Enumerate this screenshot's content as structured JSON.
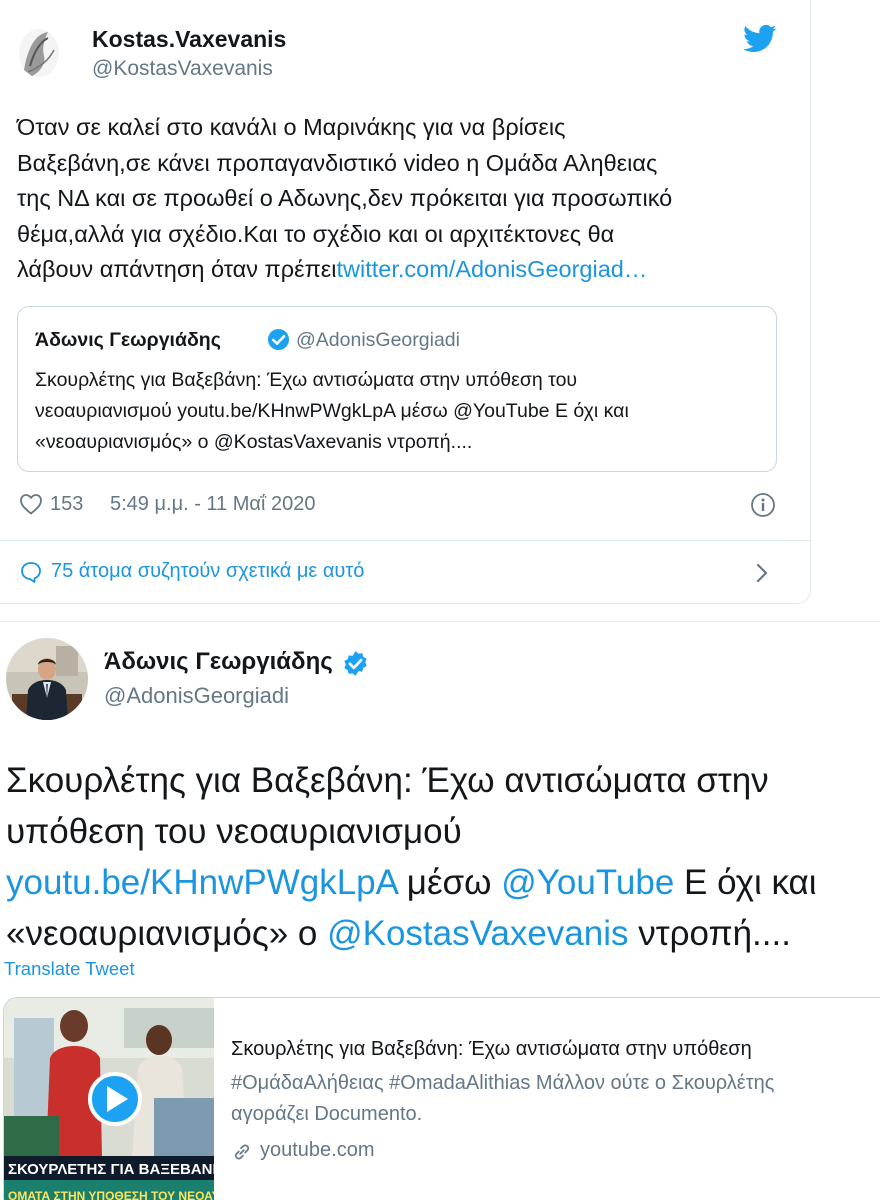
{
  "tweet1": {
    "author_name": "Kostas.Vaxevanis",
    "author_handle": "@KostasVaxevanis",
    "text_lines": [
      "Όταν σε καλεί στο κανάλι ο Μαρινάκης για να βρίσεις",
      "Βαξεβάνη,σε κάνει προπαγανδιστικό video η Ομάδα Αληθειας",
      "της ΝΔ και σε προωθεί ο Αδωνης,δεν πρόκειται για προσωπικό",
      "θέμα,αλλά για σχέδιο.Και το σχέδιο και οι αρχιτέκτονες θα"
    ],
    "text_last_line": "λάβουν απάντηση όταν πρέπει",
    "text_link": "twitter.com/AdonisGeorgiad…",
    "quoted": {
      "author_name": "Άδωνις Γεωργιάδης",
      "author_handle": "@AdonisGeorgiadi",
      "text_lines": [
        "Σκουρλέτης για Βαξεβάνη: Έχω αντισώματα στην υπόθεση του",
        "νεοαυριανισμού youtu.be/KHnwPWgkLpA μέσω @YouTube Ε όχι και",
        "«νεοαυριανισμός» ο @KostasVaxevanis ντροπή...."
      ]
    },
    "likes": "153",
    "timestamp": "5:49 μ.μ. - 11 Μαΐ 2020",
    "conversation": "75 άτομα συζητούν σχετικά με αυτό"
  },
  "tweet2": {
    "author_name": "Άδωνις Γεωργιάδης",
    "author_handle": "@AdonisGeorgiadi",
    "line1": "Σκουρλέτης για Βαξεβάνη: Έχω αντισώματα στην",
    "line2": "υπόθεση του νεοαυριανισμού",
    "line3_link1": "youtu.be/KHnwPWgkLpA",
    "line3_mid": " μέσω ",
    "line3_link2": "@YouTube",
    "line3_tail": " Ε όχι και",
    "line4_head": "«νεοαυριανισμός» ο ",
    "line4_link": "@KostasVaxevanis",
    "line4_tail": " ντροπή....",
    "translate": "Translate Tweet",
    "card": {
      "thumb_caption_1": "ΣΚΟΥΡΛΕΤΗΣ ΓΙΑ ΒΑΞΕΒΑΝΗ",
      "thumb_caption_2": "ΟΜΑΤΑ ΣΤΗΝ ΥΠΟΘΕΣΗ ΤΟΥ ΝΕΟΑΥ",
      "title": "Σκουρλέτης για Βαξεβάνη: Έχω αντισώματα στην υπόθεση",
      "desc_line1": "#ΟμάδαΑλήθειας #OmadaAlithias Μάλλον ούτε ο Σκουρλέτης",
      "desc_line2": "αγοράζει Documento.",
      "domain": "youtube.com"
    }
  },
  "colors": {
    "link": "#1b95e0",
    "muted": "#657786",
    "text": "#14171a",
    "border": "#ccd6dd"
  }
}
